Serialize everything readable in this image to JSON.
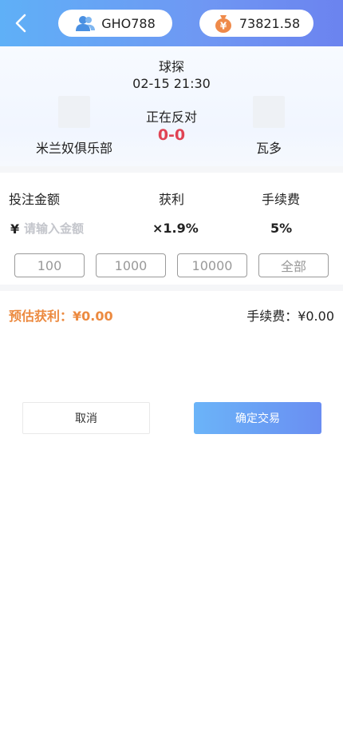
{
  "header": {
    "username": "GHO788",
    "balance": "73821.58",
    "balance_icon_glyph": "¥"
  },
  "match": {
    "title": "球探",
    "time": "02-15 21:30",
    "status": "正在反对",
    "score": "0-0",
    "home_team": "米兰奴俱乐部",
    "away_team": "瓦多"
  },
  "form": {
    "amount_label": "投注金额",
    "profit_label": "获利",
    "fee_label": "手续费",
    "currency": "¥",
    "amount_placeholder": "请输入金额",
    "amount_value": "",
    "profit_rate": "×1.9%",
    "fee_rate": "5%",
    "quick_amounts": [
      "100",
      "1000",
      "10000",
      "全部"
    ]
  },
  "summary": {
    "estimate": "预估获利：¥0.00",
    "fee": "手续费：¥0.00"
  },
  "actions": {
    "cancel_label": "取消",
    "confirm_label": "确定交易"
  },
  "colors": {
    "header_start": "#5fb0f7",
    "header_end": "#6b83ef",
    "score": "#e04354",
    "estimate": "#ec8a40",
    "user_icon": "#4a90e2",
    "money_icon": "#ef8a4a"
  }
}
